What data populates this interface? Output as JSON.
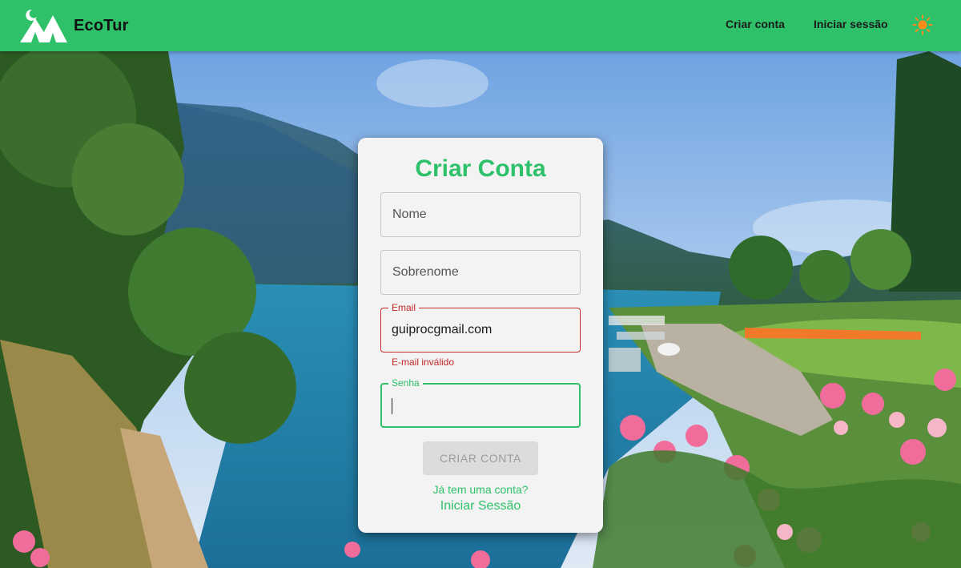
{
  "header": {
    "brand": "EcoTur",
    "nav": {
      "create_account": "Criar conta",
      "login": "Iniciar sessão"
    },
    "theme_icon": "sun-icon"
  },
  "form": {
    "title": "Criar Conta",
    "fields": {
      "name": {
        "placeholder": "Nome",
        "value": ""
      },
      "surname": {
        "placeholder": "Sobrenome",
        "value": ""
      },
      "email": {
        "label": "Email",
        "value": "guiprocgmail.com",
        "error": "E-mail inválido"
      },
      "password": {
        "label": "Senha",
        "value": ""
      }
    },
    "submit_label": "CRIAR CONTA",
    "have_account": "Já tem uma conta?",
    "login_link": "Iniciar Sessão"
  },
  "colors": {
    "brand_green": "#2ec16a",
    "error_red": "#c62828",
    "card_bg": "#f3f3f3",
    "theme_icon": "#ff8a1d"
  }
}
